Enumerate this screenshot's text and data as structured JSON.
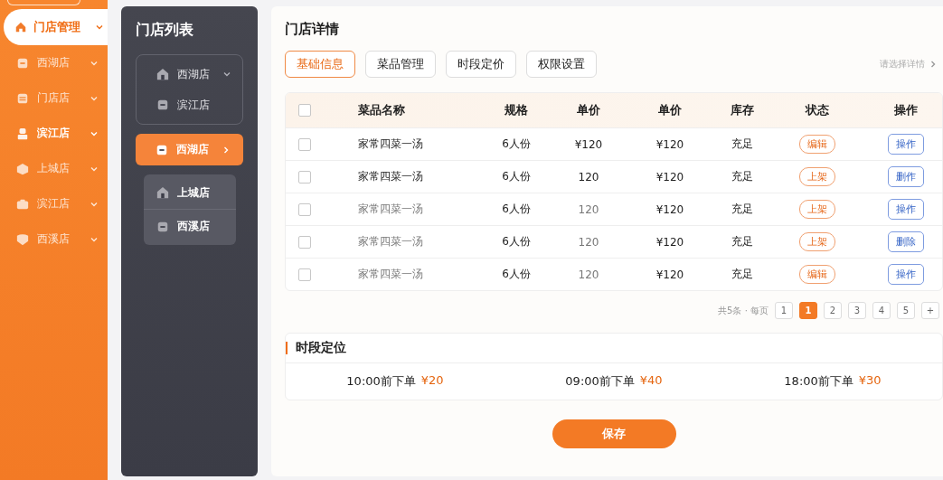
{
  "sidebar": {
    "items": [
      {
        "label": "门店管理",
        "kind": "home",
        "selected": true,
        "highlighted": false
      },
      {
        "label": "西湖店",
        "kind": "shop",
        "selected": false,
        "highlighted": false
      },
      {
        "label": "门店店",
        "kind": "db",
        "selected": false,
        "highlighted": false
      },
      {
        "label": "滨江店",
        "kind": "person",
        "selected": false,
        "highlighted": true
      },
      {
        "label": "上城店",
        "kind": "box",
        "selected": false,
        "highlighted": false
      },
      {
        "label": "滨江店",
        "kind": "case",
        "selected": false,
        "highlighted": false
      },
      {
        "label": "西溪店",
        "kind": "shield",
        "selected": false,
        "highlighted": false
      }
    ]
  },
  "store_list": {
    "title": "门店列表",
    "group": [
      {
        "label": "西湖店",
        "kind": "house",
        "expanded": true
      },
      {
        "label": "滨江店",
        "kind": "bag",
        "expanded": false
      }
    ],
    "active": {
      "label": "西湖店"
    },
    "sub_items": [
      {
        "label": "上城店",
        "kind": "house"
      },
      {
        "label": "西溪店",
        "kind": "bag"
      }
    ]
  },
  "detail": {
    "title": "门店详情",
    "tabs": [
      {
        "label": "基础信息",
        "selected": true
      },
      {
        "label": "菜品管理",
        "selected": false
      },
      {
        "label": "时段定价",
        "selected": false
      },
      {
        "label": "权限设置",
        "selected": false
      }
    ],
    "more_link": "请选择详情",
    "table": {
      "all_checked": false,
      "columns": [
        "菜品名称",
        "规格",
        "单价",
        "单价",
        "库存",
        "状态",
        "操作"
      ],
      "rows": [
        {
          "checked": false,
          "dimmed": false,
          "cells": [
            "家常四菜一汤",
            "6人份",
            "¥120",
            "¥120",
            "充足"
          ],
          "status": "编辑",
          "action": "操作"
        },
        {
          "checked": false,
          "dimmed": false,
          "cells": [
            "家常四菜一汤",
            "6人份",
            "120",
            "¥120",
            "充足"
          ],
          "status": "上架",
          "action": "删作"
        },
        {
          "checked": false,
          "dimmed": true,
          "cells": [
            "家常四菜一汤",
            "6人份",
            "120",
            "¥120",
            "充足"
          ],
          "status": "上架",
          "action": "操作"
        },
        {
          "checked": false,
          "dimmed": true,
          "cells": [
            "家常四菜一汤",
            "6人份",
            "120",
            "¥120",
            "充足"
          ],
          "status": "上架",
          "action": "删除"
        },
        {
          "checked": false,
          "dimmed": true,
          "cells": [
            "家常四菜一汤",
            "6人份",
            "120",
            "¥120",
            "充足"
          ],
          "status": "编辑",
          "action": "操作"
        }
      ]
    },
    "pagination": {
      "summary": "共5条 · 每页",
      "pages": [
        {
          "label": "1",
          "selected": false
        },
        {
          "label": "1",
          "selected": true
        },
        {
          "label": "2",
          "selected": false
        },
        {
          "label": "3",
          "selected": false
        },
        {
          "label": "4",
          "selected": false
        },
        {
          "label": "5",
          "selected": false
        },
        {
          "label": "+",
          "selected": false
        }
      ]
    },
    "time_section": {
      "title": "时段定位",
      "slots": [
        {
          "time": "10:00前下单",
          "price": "¥20"
        },
        {
          "time": "09:00前下单",
          "price": "¥40"
        },
        {
          "time": "18:00前下单",
          "price": "¥30"
        }
      ]
    },
    "save_button": "保存"
  }
}
